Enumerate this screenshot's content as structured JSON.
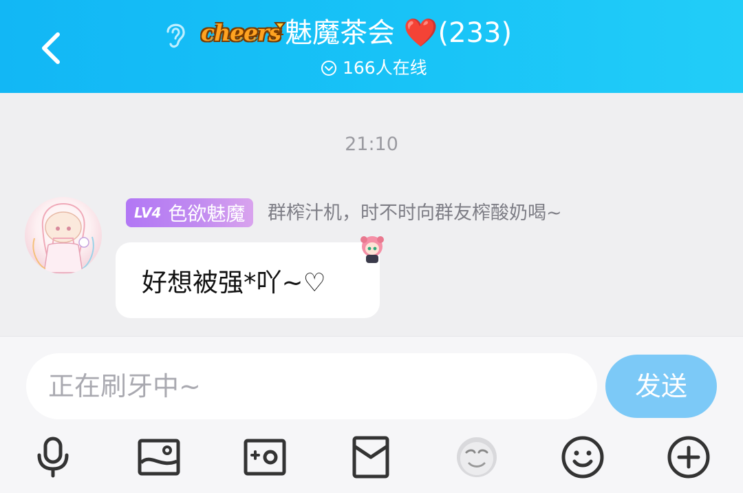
{
  "header": {
    "logo_text": "cheers",
    "title": "魅魔茶会 ❤️(233)",
    "online_text": "166人在线"
  },
  "chat": {
    "timestamp": "21:10",
    "message": {
      "badge_level": "LV4",
      "badge_title": "色欲魅魔",
      "sender_signature": "群榨汁机，时不时向群友榨酸奶喝~",
      "text": "好想被强*吖~♡"
    }
  },
  "composer": {
    "placeholder": "正在刷牙中~",
    "send_label": "发送"
  },
  "toolbar": {
    "icons": [
      "microphone-icon",
      "image-icon",
      "camera-icon",
      "red-packet-icon",
      "sticker-face-icon",
      "emoji-icon",
      "plus-icon"
    ]
  },
  "colors": {
    "header_blue": "#12b7f5",
    "send_button": "#7cc9f7",
    "badge_purple": "#b277f5"
  }
}
